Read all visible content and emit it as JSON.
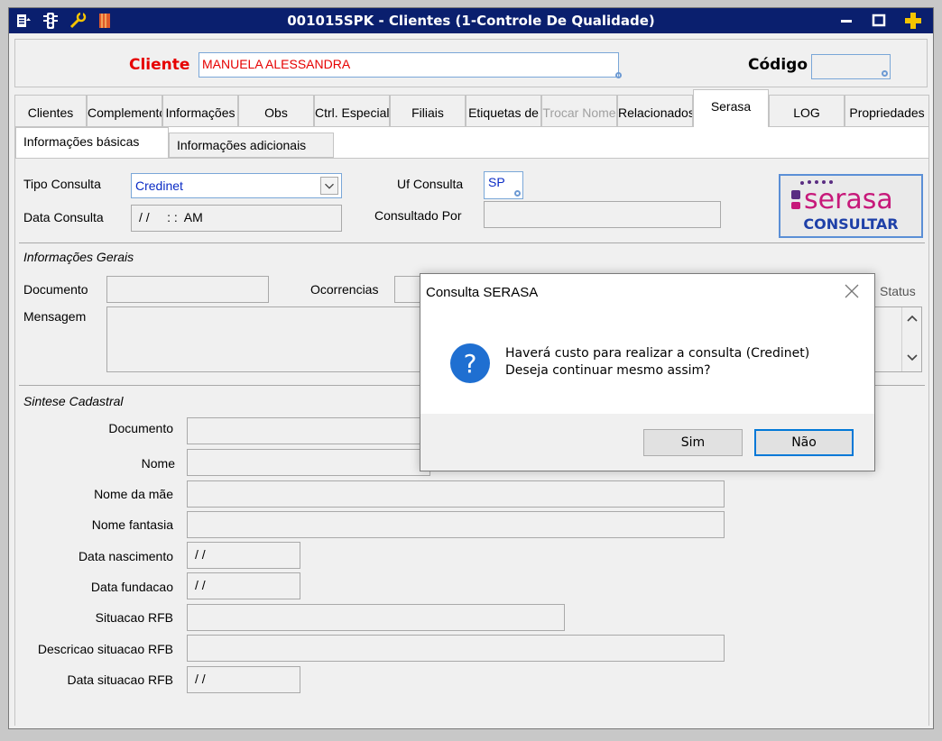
{
  "window": {
    "title": "001015SPK - Clientes (1-Controle De Qualidade)"
  },
  "header": {
    "cliente_label": "Cliente",
    "cliente_value": "MANUELA ALESSANDRA",
    "codigo_label": "Código",
    "codigo_value": ""
  },
  "tabs": [
    {
      "label": "Clientes"
    },
    {
      "label": "Complementos"
    },
    {
      "label": "Informações"
    },
    {
      "label": "Obs"
    },
    {
      "label": "Ctrl. Especial"
    },
    {
      "label": "Filiais"
    },
    {
      "label": "Etiquetas de"
    },
    {
      "label": "Trocar Nome"
    },
    {
      "label": "Relacionados"
    },
    {
      "label": "Serasa"
    },
    {
      "label": "LOG"
    },
    {
      "label": "Propriedades"
    }
  ],
  "subtabs": [
    {
      "label": "Informações básicas"
    },
    {
      "label": "Informações adicionais"
    }
  ],
  "consulta": {
    "tipo_label": "Tipo Consulta",
    "tipo_value": "Credinet",
    "uf_label": "Uf Consulta",
    "uf_value": "SP",
    "data_label": "Data Consulta",
    "data_value": "/ /     : :  AM",
    "consultado_label": "Consultado Por",
    "consultado_value": ""
  },
  "serasa_button": {
    "logo_text": "serasa",
    "label": "CONSULTAR"
  },
  "info_gerais": {
    "title": "Informações Gerais",
    "documento_label": "Documento",
    "ocorrencias_label": "Ocorrencias",
    "status_label": "Status",
    "mensagem_label": "Mensagem"
  },
  "sintese": {
    "title": "Sintese Cadastral",
    "fields": [
      {
        "label": "Documento",
        "value": ""
      },
      {
        "label": "Nome",
        "value": ""
      },
      {
        "label": "Nome da mãe",
        "value": ""
      },
      {
        "label": "Nome fantasia",
        "value": ""
      },
      {
        "label": "Data nascimento",
        "value": "/ /"
      },
      {
        "label": "Data fundacao",
        "value": "/ /"
      },
      {
        "label": "Situacao RFB",
        "value": ""
      },
      {
        "label": "Descricao situacao RFB",
        "value": ""
      },
      {
        "label": "Data situacao RFB",
        "value": "/ /"
      }
    ]
  },
  "dialog": {
    "title": "Consulta SERASA",
    "line1": "Haverá custo para realizar a consulta (Credinet)",
    "line2": "Deseja continuar mesmo assim?",
    "yes": "Sim",
    "no": "Não"
  },
  "colors": {
    "titlebar": "#0a1f6e",
    "accent_red": "#e60000",
    "serasa_pink": "#c7197a",
    "serasa_purple": "#5a2d82",
    "link_blue": "#0a2bc5"
  }
}
